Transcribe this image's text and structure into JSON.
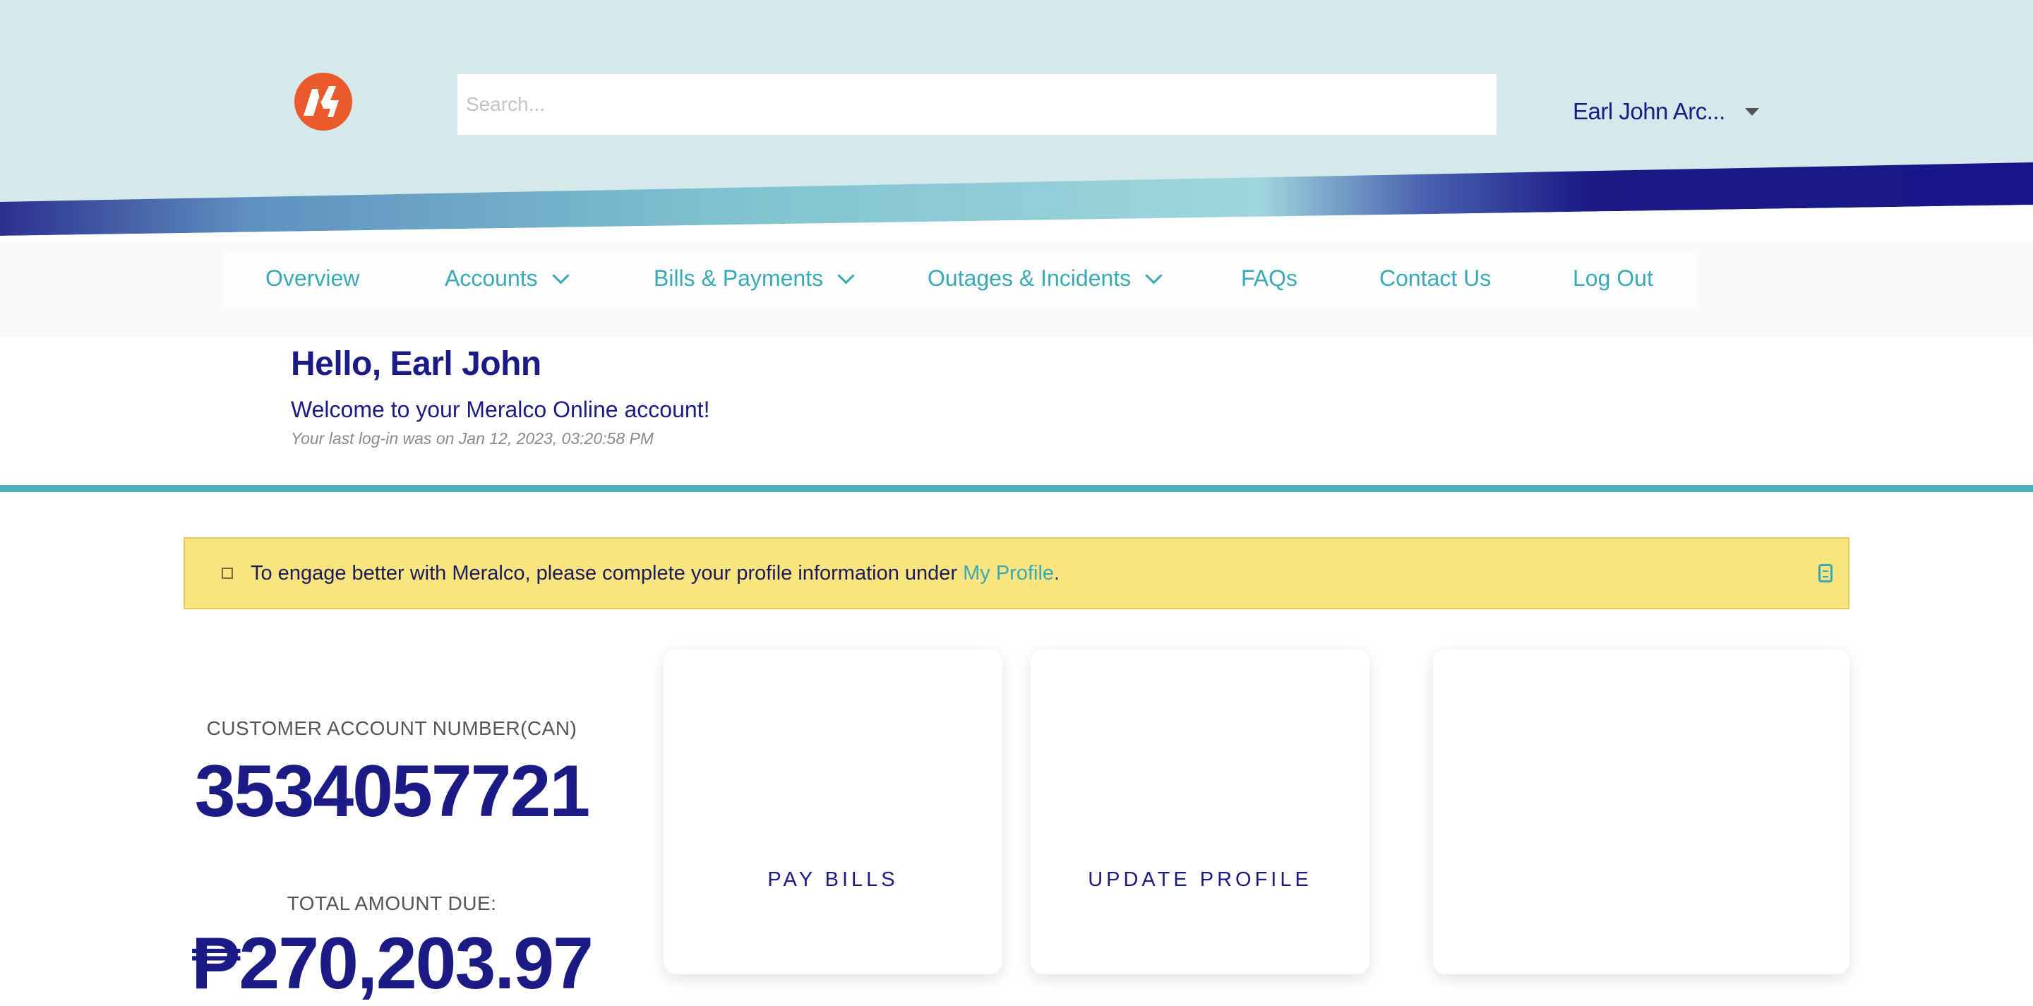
{
  "header": {
    "logo_name": "meralco-logo",
    "search_placeholder": "Search...",
    "user_name": "Earl John Arc...",
    "colors": {
      "background": "#d3e9ec",
      "brand_orange": "#ea5a2a",
      "navy": "#1b1b86",
      "teal": "#4aafbb"
    }
  },
  "nav": {
    "items": [
      {
        "label": "Overview",
        "has_dropdown": false
      },
      {
        "label": "Accounts",
        "has_dropdown": true
      },
      {
        "label": "Bills & Payments",
        "has_dropdown": true
      },
      {
        "label": "Outages & Incidents",
        "has_dropdown": true
      },
      {
        "label": "FAQs",
        "has_dropdown": false
      },
      {
        "label": "Contact Us",
        "has_dropdown": false
      },
      {
        "label": "Log Out",
        "has_dropdown": false
      }
    ]
  },
  "greeting": {
    "title": "Hello, Earl John",
    "subtitle": "Welcome to your Meralco Online account!",
    "last_login": "Your last log-in was on Jan 12, 2023, 03:20:58 PM"
  },
  "alert": {
    "text_before": "To engage better with Meralco, please complete your profile information under ",
    "link_text": "My Profile",
    "text_after": ".",
    "color": "#fae480"
  },
  "account": {
    "can_label": "CUSTOMER ACCOUNT NUMBER(CAN)",
    "can_value": "3534057721",
    "due_label": "TOTAL AMOUNT DUE:",
    "due_value": "₱270,203.97"
  },
  "cards": [
    {
      "label": "PAY BILLS"
    },
    {
      "label": "UPDATE PROFILE"
    },
    {
      "label": ""
    }
  ]
}
